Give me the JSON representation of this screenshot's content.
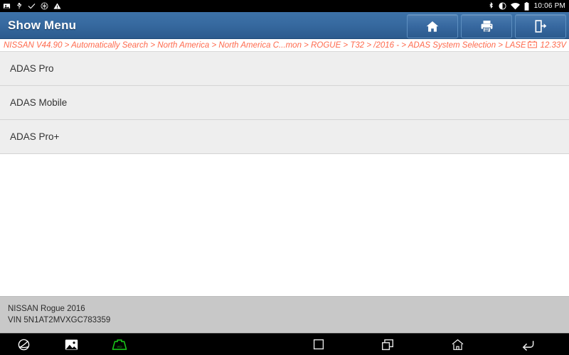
{
  "statusbar": {
    "left_icons": [
      "screenshot-icon",
      "usb-icon",
      "check-icon",
      "snowflake-icon",
      "warning-icon"
    ],
    "right_icons": [
      "bluetooth-icon",
      "do-not-disturb-icon",
      "wifi-icon",
      "battery-icon"
    ],
    "time": "10:06 PM"
  },
  "titlebar": {
    "title": "Show Menu",
    "buttons": [
      {
        "name": "home-button",
        "icon": "home-icon"
      },
      {
        "name": "print-button",
        "icon": "printer-icon"
      },
      {
        "name": "exit-button",
        "icon": "exit-icon"
      }
    ]
  },
  "breadcrumb": {
    "path": "NISSAN V44.90 > Automatically Search > North America > North America C...mon > ROGUE > T32 > /2016 - > ADAS System Selection > LASER/RADAR",
    "battery_icon": "car-battery-icon",
    "voltage": "12.33V",
    "color": "#ff6a4d"
  },
  "menu": {
    "items": [
      {
        "label": "ADAS Pro"
      },
      {
        "label": "ADAS Mobile"
      },
      {
        "label": "ADAS Pro+"
      }
    ]
  },
  "footer": {
    "vehicle": "NISSAN Rogue 2016",
    "vin": "VIN 5N1AT2MVXGC783359"
  },
  "navbar": {
    "left_items": [
      {
        "name": "browser-icon"
      },
      {
        "name": "gallery-icon"
      },
      {
        "name": "vci-icon",
        "color": "#19c219"
      }
    ],
    "right_items": [
      {
        "name": "recents-square-icon"
      },
      {
        "name": "multiwindow-icon"
      },
      {
        "name": "android-home-icon"
      },
      {
        "name": "back-icon"
      }
    ]
  }
}
